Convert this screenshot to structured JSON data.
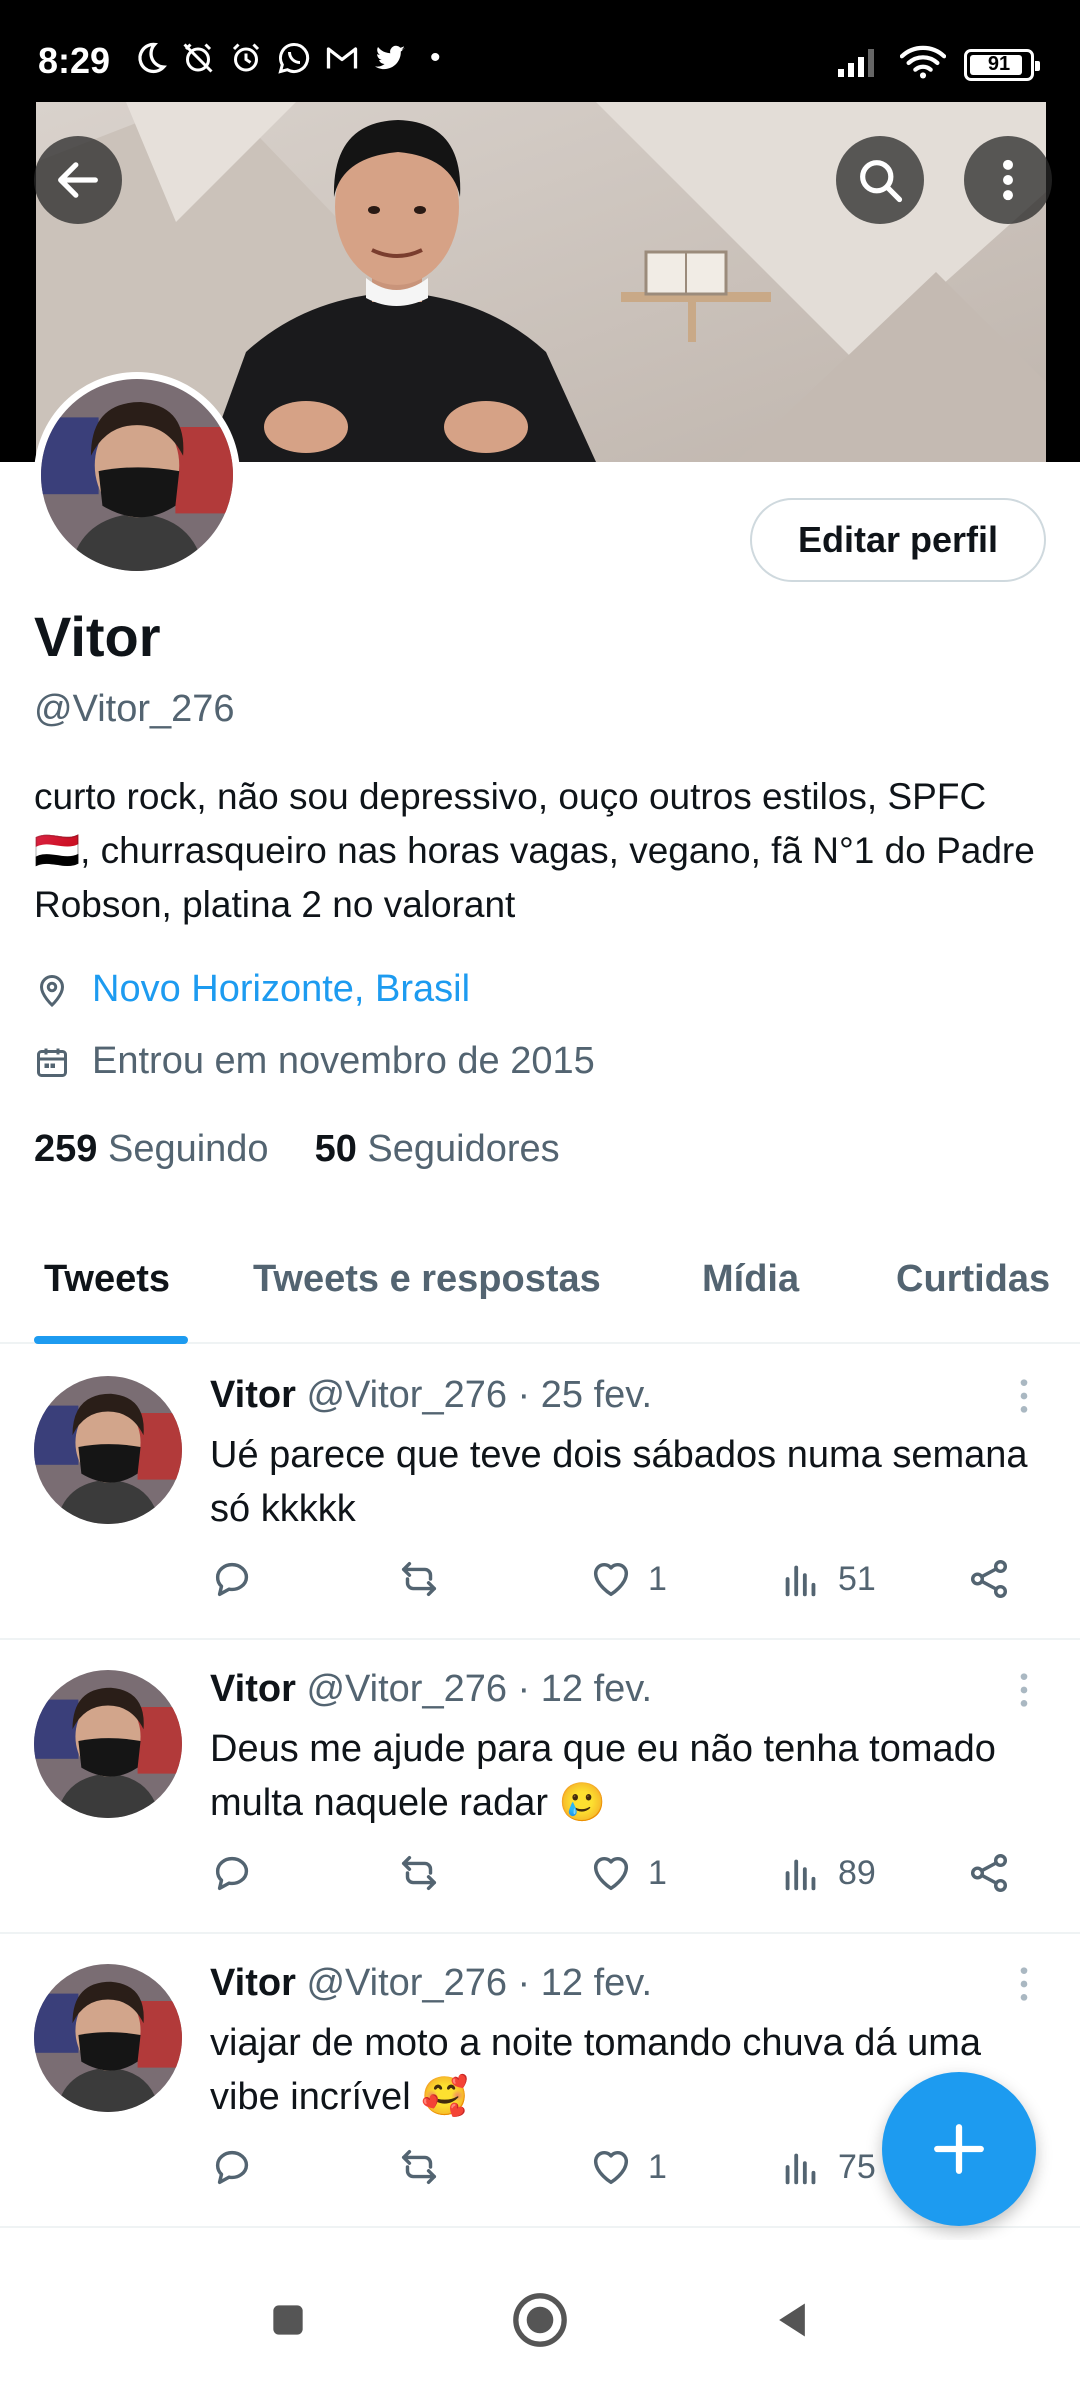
{
  "status_bar": {
    "time": "8:29",
    "battery": "91",
    "battery_level_percent": 91,
    "left_icons": [
      "moon-icon",
      "alarm-off-icon",
      "alarm-icon",
      "whatsapp-icon",
      "gmail-icon",
      "twitter-icon"
    ],
    "right_icons": [
      "signal-icon",
      "wifi-icon",
      "battery-icon"
    ]
  },
  "profile": {
    "name": "Vitor",
    "handle": "@Vitor_276",
    "bio": "curto rock, não sou depressivo, ouço outros estilos, SPFC 🇾🇪, churrasqueiro nas horas vagas, vegano, fã N°1 do Padre Robson, platina 2 no valorant",
    "location": "Novo Horizonte, Brasil",
    "joined": "Entrou em novembro de 2015",
    "following_count": "259",
    "following_label": "Seguindo",
    "followers_count": "50",
    "followers_label": "Seguidores",
    "edit_label": "Editar perfil"
  },
  "tabs": [
    {
      "label": "Tweets",
      "active": true
    },
    {
      "label": "Tweets e respostas",
      "active": false
    },
    {
      "label": "Mídia",
      "active": false
    },
    {
      "label": "Curtidas",
      "active": false
    }
  ],
  "tweets": [
    {
      "name": "Vitor",
      "meta": "@Vitor_276 · 25 fev.",
      "text": "Ué parece que teve dois sábados numa semana só kkkkk",
      "likes": "1",
      "views": "51"
    },
    {
      "name": "Vitor",
      "meta": "@Vitor_276 · 12 fev.",
      "text": "Deus me ajude para que eu não tenha tomado multa naquele radar 🥲",
      "likes": "1",
      "views": "89"
    },
    {
      "name": "Vitor",
      "meta": "@Vitor_276 · 12 fev.",
      "text": "viajar de moto a noite tomando chuva dá uma vibe incrível 🥰",
      "likes": "1",
      "views": "75"
    }
  ],
  "colors": {
    "accent": "#1d9bf0",
    "text_primary": "#0f1419",
    "text_secondary": "#536471",
    "divider": "#eff3f4"
  }
}
